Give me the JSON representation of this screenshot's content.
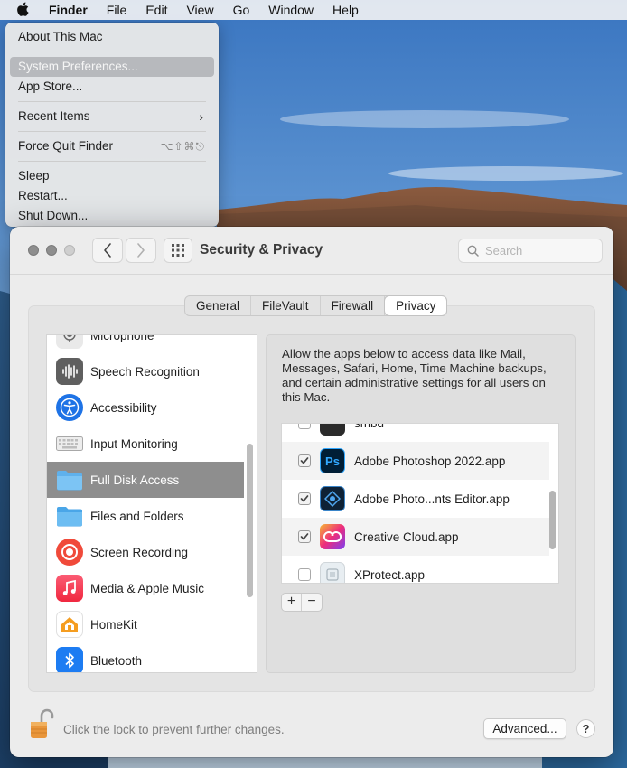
{
  "menubar": {
    "app": "Finder",
    "items": [
      "File",
      "Edit",
      "View",
      "Go",
      "Window",
      "Help"
    ]
  },
  "apple_menu": {
    "about": "About This Mac",
    "system_prefs": "System Preferences...",
    "app_store": "App Store...",
    "recent_items": "Recent Items",
    "force_quit": "Force Quit Finder",
    "force_quit_shortcut": "⌥⇧⌘⎋",
    "sleep": "Sleep",
    "restart": "Restart...",
    "shut_down": "Shut Down..."
  },
  "window": {
    "title": "Security & Privacy",
    "search_placeholder": "Search"
  },
  "tabs": [
    "General",
    "FileVault",
    "Firewall",
    "Privacy"
  ],
  "active_tab": "Privacy",
  "categories": [
    {
      "label": "Microphone",
      "icon": "microphone-icon"
    },
    {
      "label": "Speech Recognition",
      "icon": "speech-recognition-icon"
    },
    {
      "label": "Accessibility",
      "icon": "accessibility-icon"
    },
    {
      "label": "Input Monitoring",
      "icon": "keyboard-icon"
    },
    {
      "label": "Full Disk Access",
      "icon": "folder-icon",
      "selected": true
    },
    {
      "label": "Files and Folders",
      "icon": "folder-icon"
    },
    {
      "label": "Screen Recording",
      "icon": "screen-recording-icon"
    },
    {
      "label": "Media & Apple Music",
      "icon": "music-icon"
    },
    {
      "label": "HomeKit",
      "icon": "home-icon"
    },
    {
      "label": "Bluetooth",
      "icon": "bluetooth-icon"
    }
  ],
  "description": "Allow the apps below to access data like Mail, Messages, Safari, Home, Time Machine backups, and certain administrative settings for all users on this Mac.",
  "apps": [
    {
      "label": "smbd",
      "checked": false
    },
    {
      "label": "Adobe Photoshop 2022.app",
      "checked": true
    },
    {
      "label": "Adobe Photo...nts Editor.app",
      "checked": true
    },
    {
      "label": "Creative Cloud.app",
      "checked": true
    },
    {
      "label": "XProtect.app",
      "checked": false
    }
  ],
  "buttons": {
    "add": "+",
    "remove": "−",
    "advanced": "Advanced...",
    "help": "?"
  },
  "lock_text": "Click the lock to prevent further changes.",
  "colors": {
    "selection": "#8e8e8e",
    "menu_highlight": "#b7b9bd"
  }
}
